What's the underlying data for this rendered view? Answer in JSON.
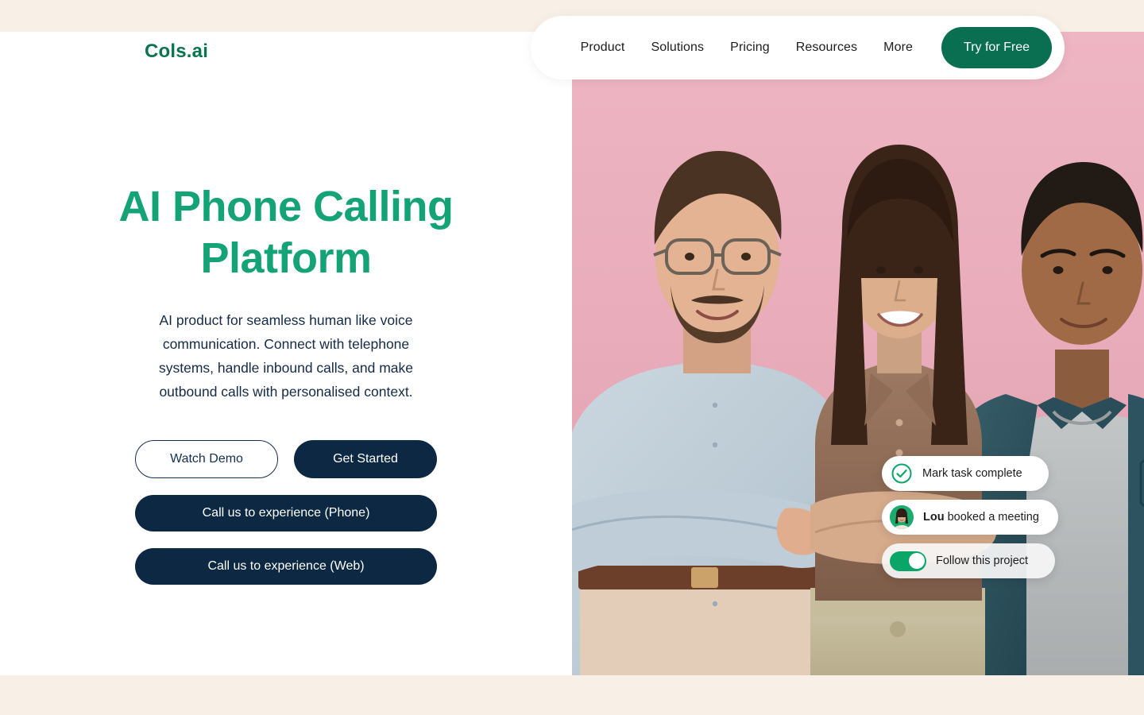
{
  "brand": {
    "logo_text": "Cols.ai",
    "logo_color": "#0a7350"
  },
  "nav": {
    "links": [
      {
        "label": "Product"
      },
      {
        "label": "Solutions"
      },
      {
        "label": "Pricing"
      },
      {
        "label": "Resources"
      },
      {
        "label": "More"
      }
    ],
    "cta_label": "Try for Free",
    "cta_color": "#0a6e50"
  },
  "hero": {
    "headline": "AI Phone Calling Platform",
    "headline_color": "#14a374",
    "subtext": "AI product for seamless human like voice communication. Connect with telephone systems, handle inbound calls, and make outbound calls with personalised context.",
    "subtext_color": "#142a47",
    "buttons": {
      "watch_demo": "Watch Demo",
      "get_started": "Get Started",
      "call_phone": "Call us to experience (Phone)",
      "call_web": "Call us to experience (Web)"
    },
    "button_solid_color": "#0d2843"
  },
  "floating_cards": [
    {
      "icon": "check-circle-icon",
      "text": "Mark task complete",
      "accent": "#0aa568"
    },
    {
      "icon": "avatar-icon",
      "name": "Lou",
      "text": " booked a meeting",
      "accent": "#1aab6f"
    },
    {
      "icon": "toggle-on-icon",
      "text": "Follow this project",
      "accent": "#0aa568"
    }
  ],
  "theme": {
    "band_cream": "#f8f0e7",
    "photo_background_pink": "#e8aebc",
    "page_background": "#ffffff"
  }
}
